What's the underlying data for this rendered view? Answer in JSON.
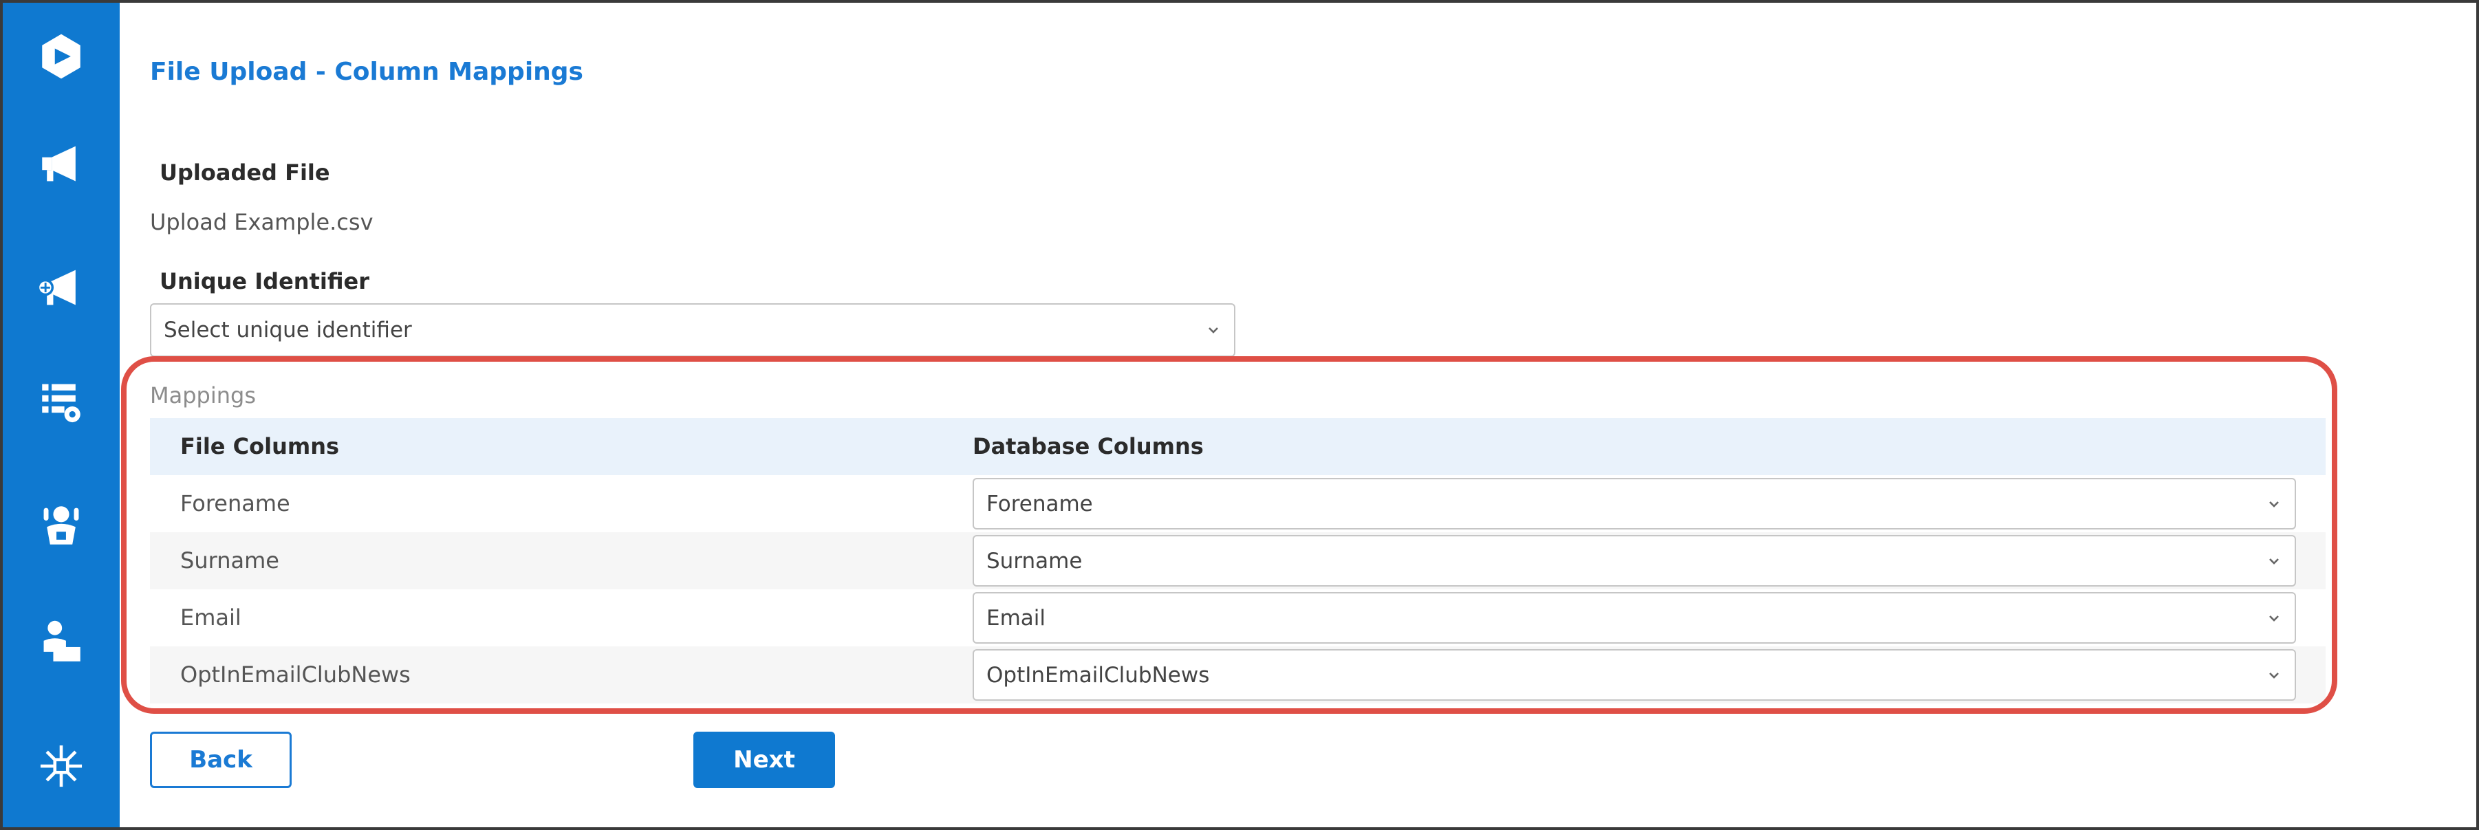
{
  "sidebar": {
    "icons": [
      "logo-icon",
      "campaigns-megaphone-icon",
      "add-campaign-megaphone-icon",
      "list-settings-icon",
      "support-agent-icon",
      "presenter-icon",
      "snowflake-grid-icon"
    ],
    "color": "#0f79d0"
  },
  "page": {
    "title": "File Upload - Column Mappings"
  },
  "uploaded_file": {
    "label": "Uploaded File",
    "value": "Upload Example.csv"
  },
  "unique_identifier": {
    "label": "Unique Identifier",
    "selected": "Select unique identifier"
  },
  "mappings": {
    "title": "Mappings",
    "headers": [
      "File Columns",
      "Database Columns"
    ],
    "rows": [
      {
        "file_column": "Forename",
        "database_column": "Forename"
      },
      {
        "file_column": "Surname",
        "database_column": "Surname"
      },
      {
        "file_column": "Email",
        "database_column": "Email"
      },
      {
        "file_column": "OptInEmailClubNews",
        "database_column": "OptInEmailClubNews"
      }
    ]
  },
  "buttons": {
    "back": "Back",
    "next": "Next"
  },
  "colors": {
    "accent": "#1a7ad4",
    "highlight": "#df4f46",
    "header_bg": "#e9f2fb"
  }
}
